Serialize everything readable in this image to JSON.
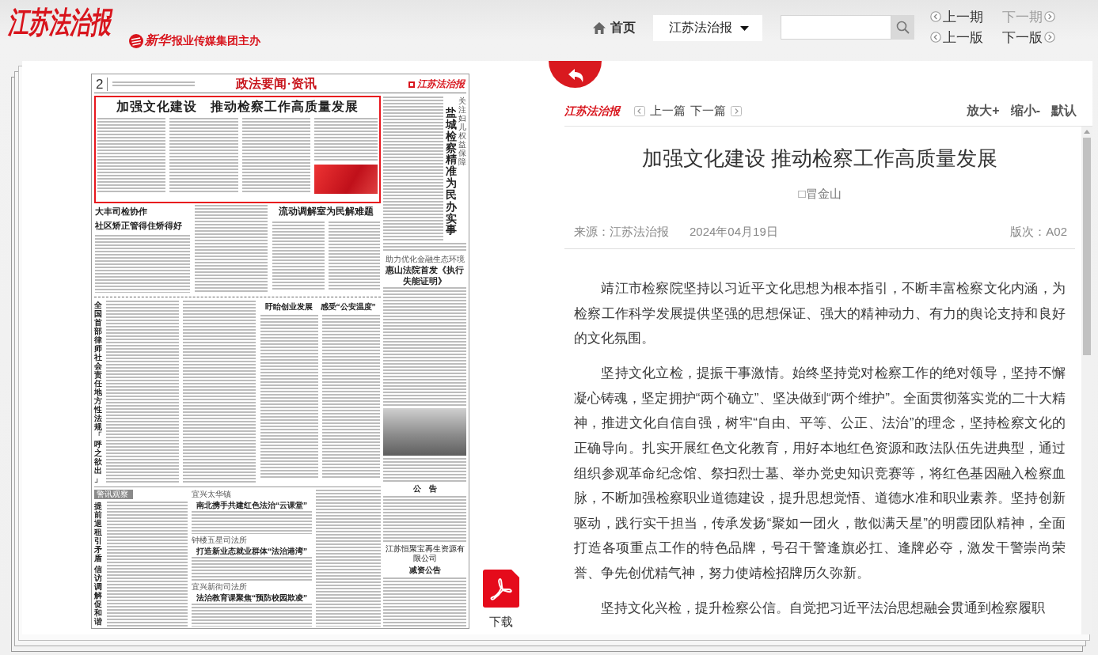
{
  "header": {
    "masthead": "江苏法治报",
    "publisher_mark": "新华",
    "publisher": "报业传媒集团主办",
    "home": "首页",
    "paper_select": {
      "value": "江苏法治报"
    },
    "pager": [
      {
        "label": "上一期",
        "kind": "previous",
        "disabled": false
      },
      {
        "label": "下一期",
        "kind": "next",
        "disabled": true
      },
      {
        "label": "上一版",
        "kind": "previous",
        "disabled": false
      },
      {
        "label": "下一版",
        "kind": "next",
        "disabled": false
      }
    ]
  },
  "newspaper_page": {
    "page_number": "2",
    "section": "政法要闻·资讯",
    "masthead": "江苏法治报",
    "lead_story": {
      "headline": "加强文化建设　推动检察工作高质量发展",
      "selected": true
    },
    "side_story": {
      "kicker": "关注妇儿权益保障",
      "headline": "盐城检察精准为民办实事",
      "selected": false
    },
    "middle_stories": [
      {
        "headline": [
          "大丰司检协作",
          "社区矫正管得住矫得好"
        ],
        "selected": false
      },
      {
        "headline": [
          "流动调解室为民解难题"
        ],
        "selected": false
      }
    ],
    "court_story": {
      "kicker": "助力优化金融生态环境",
      "headline": "惠山法院首发《执行失能证明》",
      "selected": false
    },
    "feature_stories": [
      {
        "headline": "全国首部律师社会责任地方性法规「呼之欲出」",
        "selected": false
      },
      {
        "headline": "盱眙创业发展　感受“公安温度”",
        "selected": false
      }
    ],
    "column_tag": "警讯观察",
    "bottom_stories": [
      {
        "headline": [
          "提前退租引矛盾",
          "信访调解促和谐"
        ],
        "selected": false
      },
      {
        "kicker": "宜兴太华镇",
        "headline": "南北携手共建红色法治“云课堂”",
        "selected": false
      },
      {
        "kicker": "钟楼五星司法所",
        "headline": "打造新业态就业群体“法治港湾”",
        "selected": false
      },
      {
        "kicker": "宜兴新街司法所",
        "headline": "法治教育课聚焦“预防校园欺凌”",
        "selected": false
      }
    ],
    "notices": [
      {
        "title": "公　告"
      },
      {
        "title": "江苏恒聚宝再生资源有限公司",
        "subtitle": "减资公告"
      }
    ]
  },
  "download": {
    "label": "下载"
  },
  "article_toolbar": {
    "logo": "江苏法治报",
    "previous": "上一篇",
    "next": "下一篇",
    "zoom_in": "放大+",
    "zoom_out": "缩小-",
    "reset": "默认"
  },
  "article": {
    "title": "加强文化建设 推动检察工作高质量发展",
    "byline": "□冒金山",
    "source": "来源：江苏法治报",
    "date": "2024年04月19日",
    "edition": "版次：A02",
    "paragraphs": [
      "靖江市检察院坚持以习近平文化思想为根本指引，不断丰富检察文化内涵，为检察工作科学发展提供坚强的思想保证、强大的精神动力、有力的舆论支持和良好的文化氛围。",
      "坚持文化立检，提振干事激情。始终坚持党对检察工作的绝对领导，坚持不懈凝心铸魂，坚定拥护“两个确立”、坚决做到“两个维护”。全面贯彻落实党的二十大精神，推进文化自信自强，树牢“自由、平等、公正、法治”的理念，坚持检察文化的正确导向。扎实开展红色文化教育，用好本地红色资源和政法队伍先进典型，通过组织参观革命纪念馆、祭扫烈士墓、举办党史知识竞赛等，将红色基因融入检察血脉，不断加强检察职业道德建设，提升思想觉悟、道德水准和职业素养。坚持创新驱动，践行实干担当，传承发扬“聚如一团火，散似满天星”的明霞团队精神，全面打造各项重点工作的特色品牌，号召干警逢旗必扛、逢牌必夺，激发干警崇尚荣誉、争先创优精气神，努力使靖检招牌历久弥新。",
      "坚持文化兴检，提升检察公信。自觉把习近平法治思想融会贯通到检察履职"
    ]
  }
}
